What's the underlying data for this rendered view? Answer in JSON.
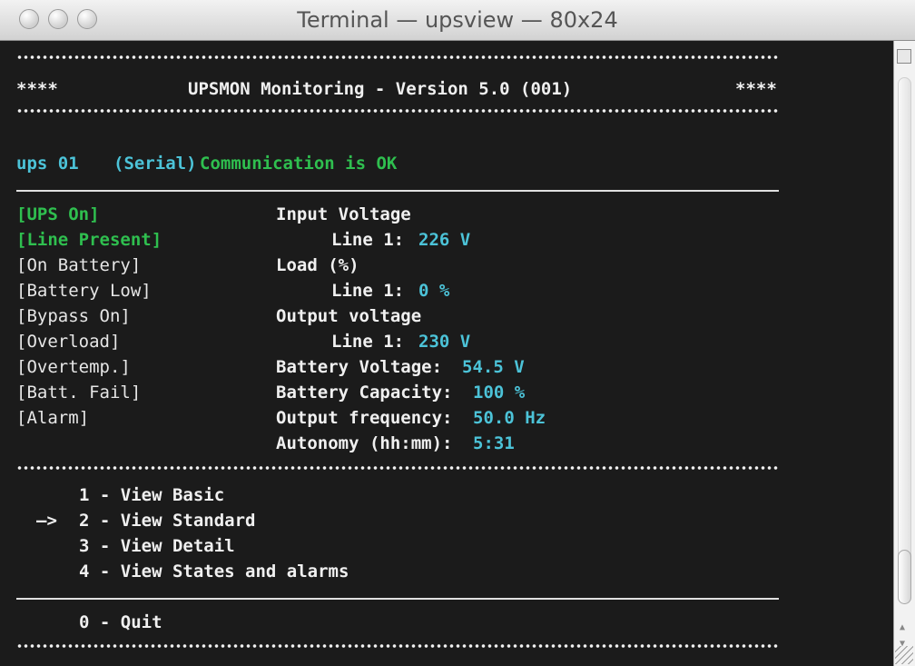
{
  "window": {
    "title": "Terminal — upsview — 80x24"
  },
  "header": {
    "left_marks": "****",
    "title": "UPSMON Monitoring - Version 5.0 (001)",
    "right_marks": "****"
  },
  "status": {
    "ups": "ups 01",
    "mode": "(Serial)",
    "message": "Communication is OK"
  },
  "states": [
    {
      "label": "[UPS On]",
      "active": true
    },
    {
      "label": "[Line Present]",
      "active": true
    },
    {
      "label": "[On Battery]",
      "active": false
    },
    {
      "label": "[Battery Low]",
      "active": false
    },
    {
      "label": "[Bypass On]",
      "active": false
    },
    {
      "label": "[Overload]",
      "active": false
    },
    {
      "label": "[Overtemp.]",
      "active": false
    },
    {
      "label": "[Batt. Fail]",
      "active": false
    },
    {
      "label": "[Alarm]",
      "active": false
    }
  ],
  "readings": {
    "input_voltage_label": "Input Voltage",
    "input_line1_label": "Line 1:",
    "input_line1_value": "226 V",
    "load_label": "Load (%)",
    "load_line1_label": "Line 1:",
    "load_line1_value": "0 %",
    "output_voltage_label": "Output voltage",
    "output_line1_label": "Line 1:",
    "output_line1_value": "230 V",
    "battery_voltage_label": "Battery Voltage:",
    "battery_voltage_value": "54.5 V",
    "battery_capacity_label": "Battery Capacity:",
    "battery_capacity_value": "100 %",
    "output_frequency_label": "Output frequency:",
    "output_frequency_value": "50.0 Hz",
    "autonomy_label": "Autonomy (hh:mm):",
    "autonomy_value": "5:31"
  },
  "menu": {
    "selected_marker": "—>",
    "items": [
      "1 - View Basic",
      "2 - View Standard",
      "3 - View Detail",
      "4 - View States and alarms"
    ],
    "quit": "0 - Quit"
  },
  "colors": {
    "green": "#2fbf4f",
    "cyan": "#4cc3d8",
    "background": "#1b1b1b"
  }
}
